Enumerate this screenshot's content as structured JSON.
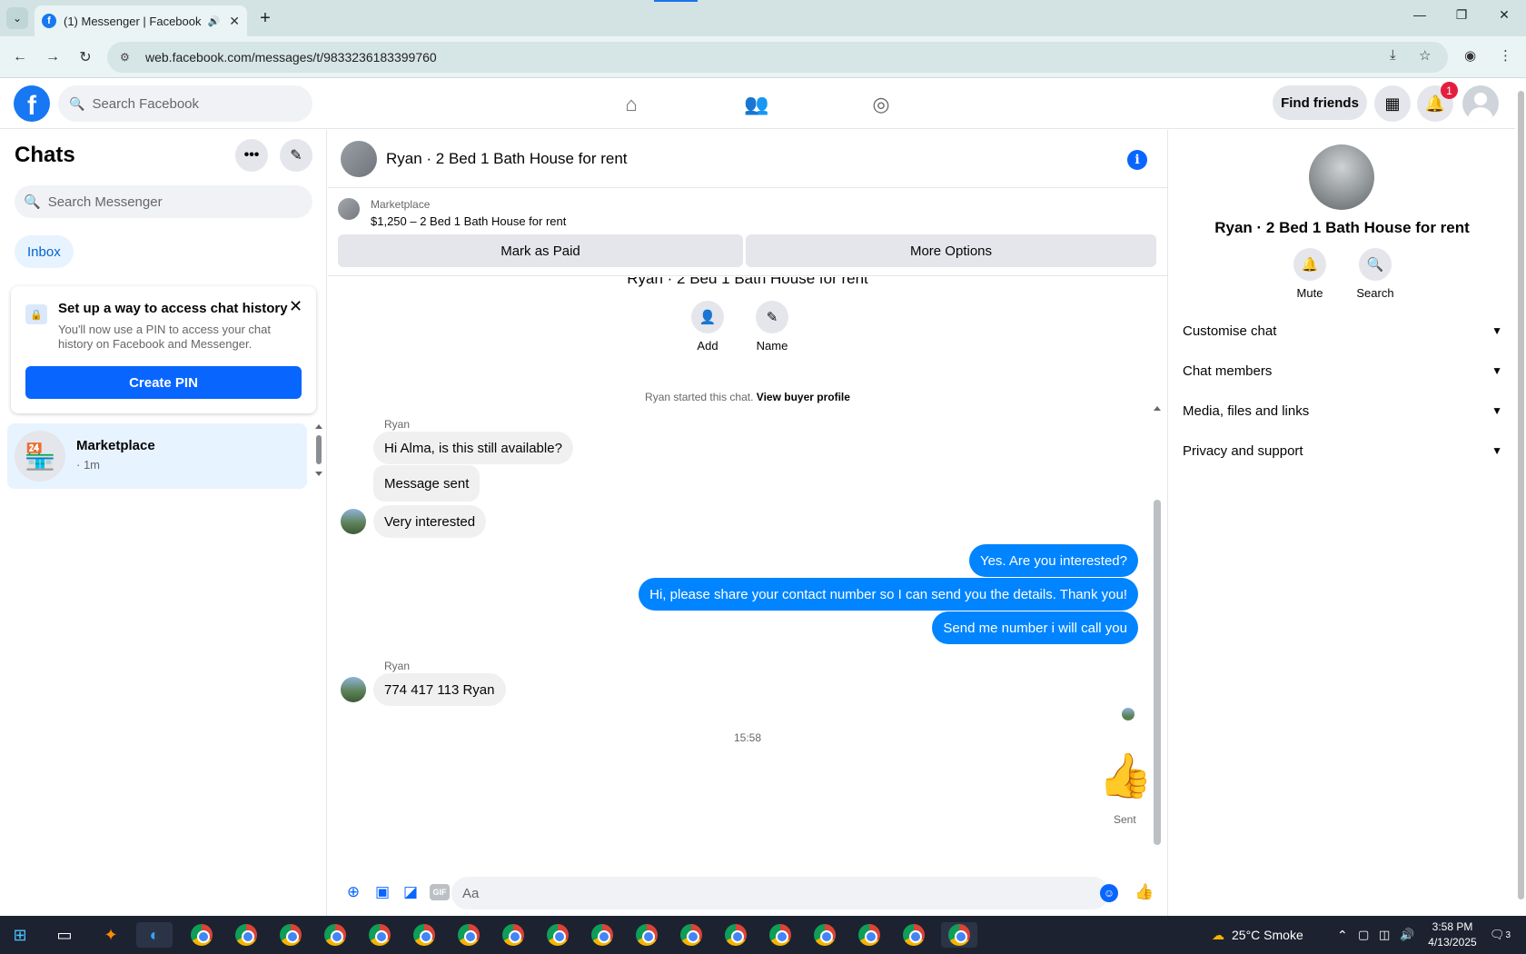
{
  "browser": {
    "tab_title": "(1) Messenger | Facebook",
    "url": "web.facebook.com/messages/t/9833236183399760"
  },
  "fb": {
    "search_placeholder": "Search Facebook",
    "find_friends": "Find friends",
    "notif_count": "1",
    "accent": "#1877f2"
  },
  "chats": {
    "title": "Chats",
    "search_placeholder": "Search Messenger",
    "inbox_label": "Inbox",
    "pin_card": {
      "title": "Set up a way to access chat history",
      "body": "You'll now use a PIN to access your chat history on Facebook and Messenger.",
      "button": "Create PIN"
    },
    "conversation": {
      "name": "Marketplace",
      "time": "· 1m"
    }
  },
  "chat": {
    "header_name": "Ryan · 2 Bed 1 Bath House for rent",
    "marketplace_label": "Marketplace",
    "listing": "$1,250 – 2 Bed 1 Bath House for rent",
    "mark_paid": "Mark as Paid",
    "more_options": "More Options",
    "intro_title": "Ryan · 2 Bed 1 Bath House for rent",
    "add_label": "Add",
    "name_label": "Name",
    "started_text": "Ryan started this chat.",
    "view_profile": "View buyer profile",
    "sender_name": "Ryan",
    "messages_in_1": [
      "Hi Alma, is this still available?",
      "Message sent",
      "Very interested"
    ],
    "messages_out": [
      "Yes. Are you interested?",
      "Hi, please share your contact number so I can send you the details. Thank you!",
      "Send me number i will call you"
    ],
    "sender_name_2": "Ryan",
    "message_in_2": "774 417 113  Ryan",
    "timestamp": "15:58",
    "sent_label": "Sent",
    "composer_placeholder": "Aa",
    "gif_label": "GIF"
  },
  "info_panel": {
    "name": "Ryan · 2 Bed 1 Bath House for rent",
    "mute": "Mute",
    "search": "Search",
    "sections": [
      "Customise chat",
      "Chat members",
      "Media, files and links",
      "Privacy and support"
    ]
  },
  "taskbar": {
    "weather": "25°C  Smoke",
    "time": "3:58 PM",
    "date": "4/13/2025",
    "notif_count": "3"
  }
}
